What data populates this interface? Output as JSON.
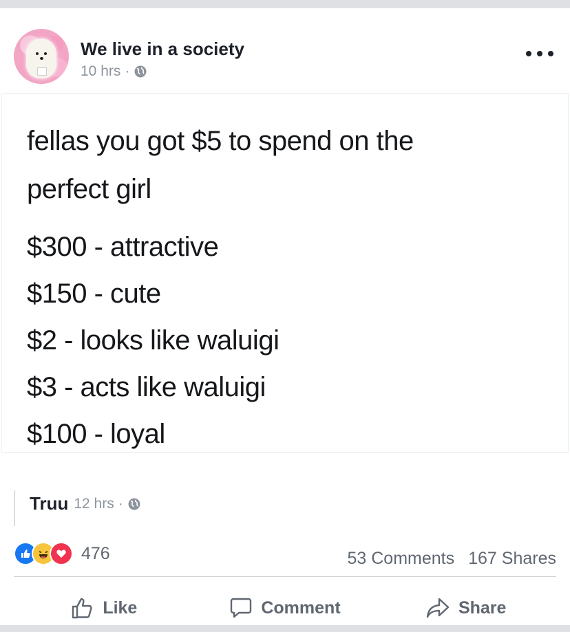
{
  "post": {
    "author": "We live in a society",
    "time": "10 hrs",
    "dot": "·",
    "privacy_icon": "globe-icon",
    "more_icon": "more-dots-icon",
    "avatar": "pomeranian-dog-avatar"
  },
  "image_text": {
    "lines": [
      "fellas you got $5 to spend on the",
      "perfect girl",
      "$300 - attractive",
      "$150 - cute",
      "$2 - looks like waluigi",
      "$3 - acts like waluigi",
      "$100 - loyal"
    ]
  },
  "comment": {
    "author": "Truu",
    "time": "12 hrs",
    "dot": "·"
  },
  "stats": {
    "reactions": "476",
    "comments": "53 Comments",
    "shares": "167 Shares",
    "reaction_icons": [
      "like-icon",
      "haha-icon",
      "love-icon"
    ]
  },
  "actions": {
    "like": "Like",
    "comment": "Comment",
    "share": "Share"
  },
  "colors": {
    "like_blue": "#1877f2",
    "haha_yellow": "#f7c43c",
    "love_red": "#f0334f",
    "text_primary": "#1d2129",
    "text_secondary": "#606770"
  }
}
